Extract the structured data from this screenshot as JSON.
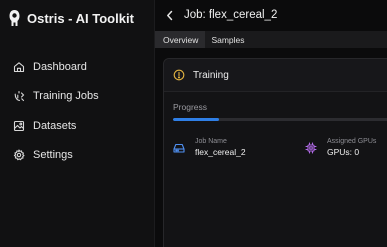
{
  "app": {
    "title": "Ostris - AI Toolkit",
    "logo_icon": "ostris-logo-icon"
  },
  "sidebar": {
    "items": [
      {
        "label": "Dashboard",
        "icon": "home-icon"
      },
      {
        "label": "Training Jobs",
        "icon": "training-jobs-icon"
      },
      {
        "label": "Datasets",
        "icon": "image-gallery-icon"
      },
      {
        "label": "Settings",
        "icon": "gear-icon"
      }
    ]
  },
  "header": {
    "title": "Job: flex_cereal_2",
    "back_icon": "chevron-left-icon"
  },
  "tabs": [
    {
      "label": "Overview",
      "active": true
    },
    {
      "label": "Samples",
      "active": false
    }
  ],
  "status": {
    "text": "Training",
    "icon": "info-circle-icon",
    "color": "#e3b341"
  },
  "progress": {
    "label": "Progress",
    "value": 0.2,
    "color": "#2f7fe6"
  },
  "job_info": {
    "name_label": "Job Name",
    "name_value": "flex_cereal_2",
    "gpu_label": "Assigned GPUs",
    "gpu_value": "GPUs: 0"
  },
  "colors": {
    "job_name_icon": "#4f8ff0",
    "gpu_icon": "#b06ae6"
  }
}
